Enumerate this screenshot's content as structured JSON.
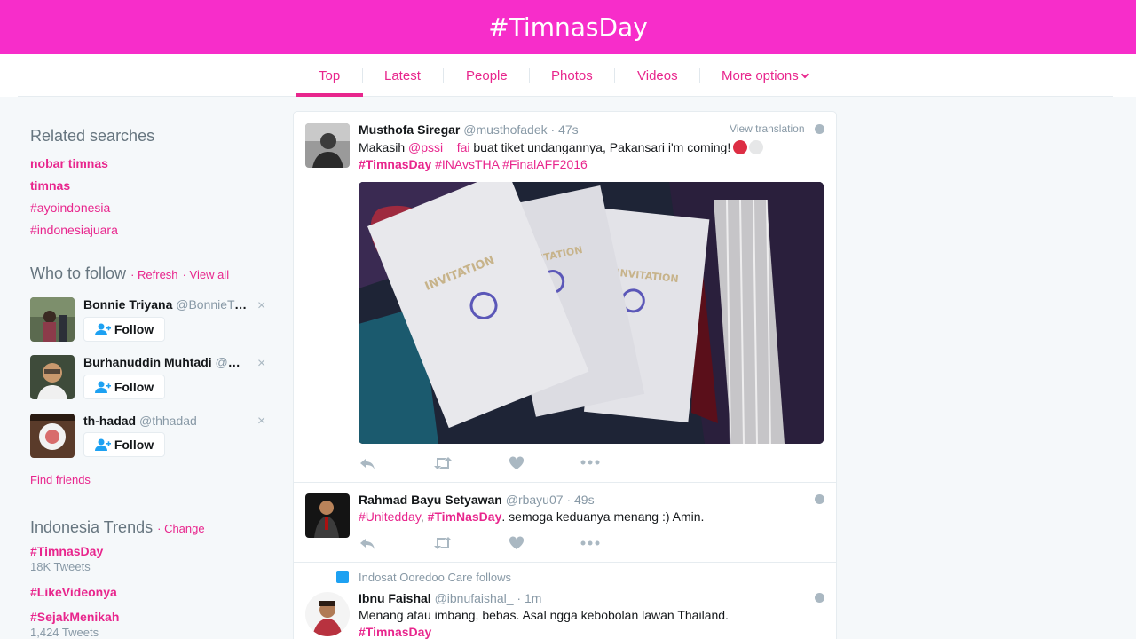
{
  "header": {
    "title": "#TimnasDay"
  },
  "nav": {
    "tabs": [
      {
        "label": "Top"
      },
      {
        "label": "Latest"
      },
      {
        "label": "People"
      },
      {
        "label": "Photos"
      },
      {
        "label": "Videos"
      },
      {
        "label": "More options"
      }
    ],
    "active_tab": "Top"
  },
  "related": {
    "title": "Related searches",
    "items": [
      {
        "label": "nobar timnas"
      },
      {
        "label": "timnas"
      },
      {
        "label": "#ayoindonesia"
      },
      {
        "label": "#indonesiajuara"
      }
    ]
  },
  "who_to_follow": {
    "title": "Who to follow",
    "refresh": "Refresh",
    "view_all": "View all",
    "follow_label": "Follow",
    "find_friends": "Find friends",
    "users": [
      {
        "name": "Bonnie Triyana",
        "handle": "@BonnieTri..."
      },
      {
        "name": "Burhanuddin Muhtadi",
        "handle": "@Bu..."
      },
      {
        "name": "th-hadad",
        "handle": "@thhadad"
      }
    ]
  },
  "trends": {
    "title": "Indonesia Trends",
    "change": "Change",
    "items": [
      {
        "tag": "#TimnasDay",
        "count": "18K Tweets"
      },
      {
        "tag": "#LikeVideonya",
        "count": ""
      },
      {
        "tag": "#SejakMenikah",
        "count": "1,424 Tweets"
      }
    ]
  },
  "tweets": [
    {
      "name": "Musthofa Siregar",
      "handle": "@musthofadek",
      "time": "47s",
      "view_translation": "View translation",
      "text_a": "Makasih ",
      "mention": "@pssi__fai",
      "text_b": " buat tiket undangannya, Pakansari i'm coming!",
      "tag_bold": "#TimnasDay",
      "tags_rest": " #INAvsTHA #FinalAFF2016",
      "photo_alt": "PSSI INVITATION"
    },
    {
      "name": "Rahmad Bayu Setyawan",
      "handle": "@rbayu07",
      "time": "49s",
      "tag1": "#Unitedday",
      "comma": ", ",
      "tag2": "#TimNasDay",
      "text": ". semoga keduanya menang :) Amin."
    },
    {
      "follows_note": "Indosat Ooredoo Care follows",
      "name": "Ibnu Faishal",
      "handle": "@ibnufaishal_",
      "time": "1m",
      "text": "Menang atau imbang, bebas. Asal ngga kebobolan lawan Thailand.",
      "tag": "#TimnasDay"
    }
  ],
  "colors": {
    "brand": "#f72dca",
    "link": "#e8268d",
    "muted": "#8899a6"
  }
}
